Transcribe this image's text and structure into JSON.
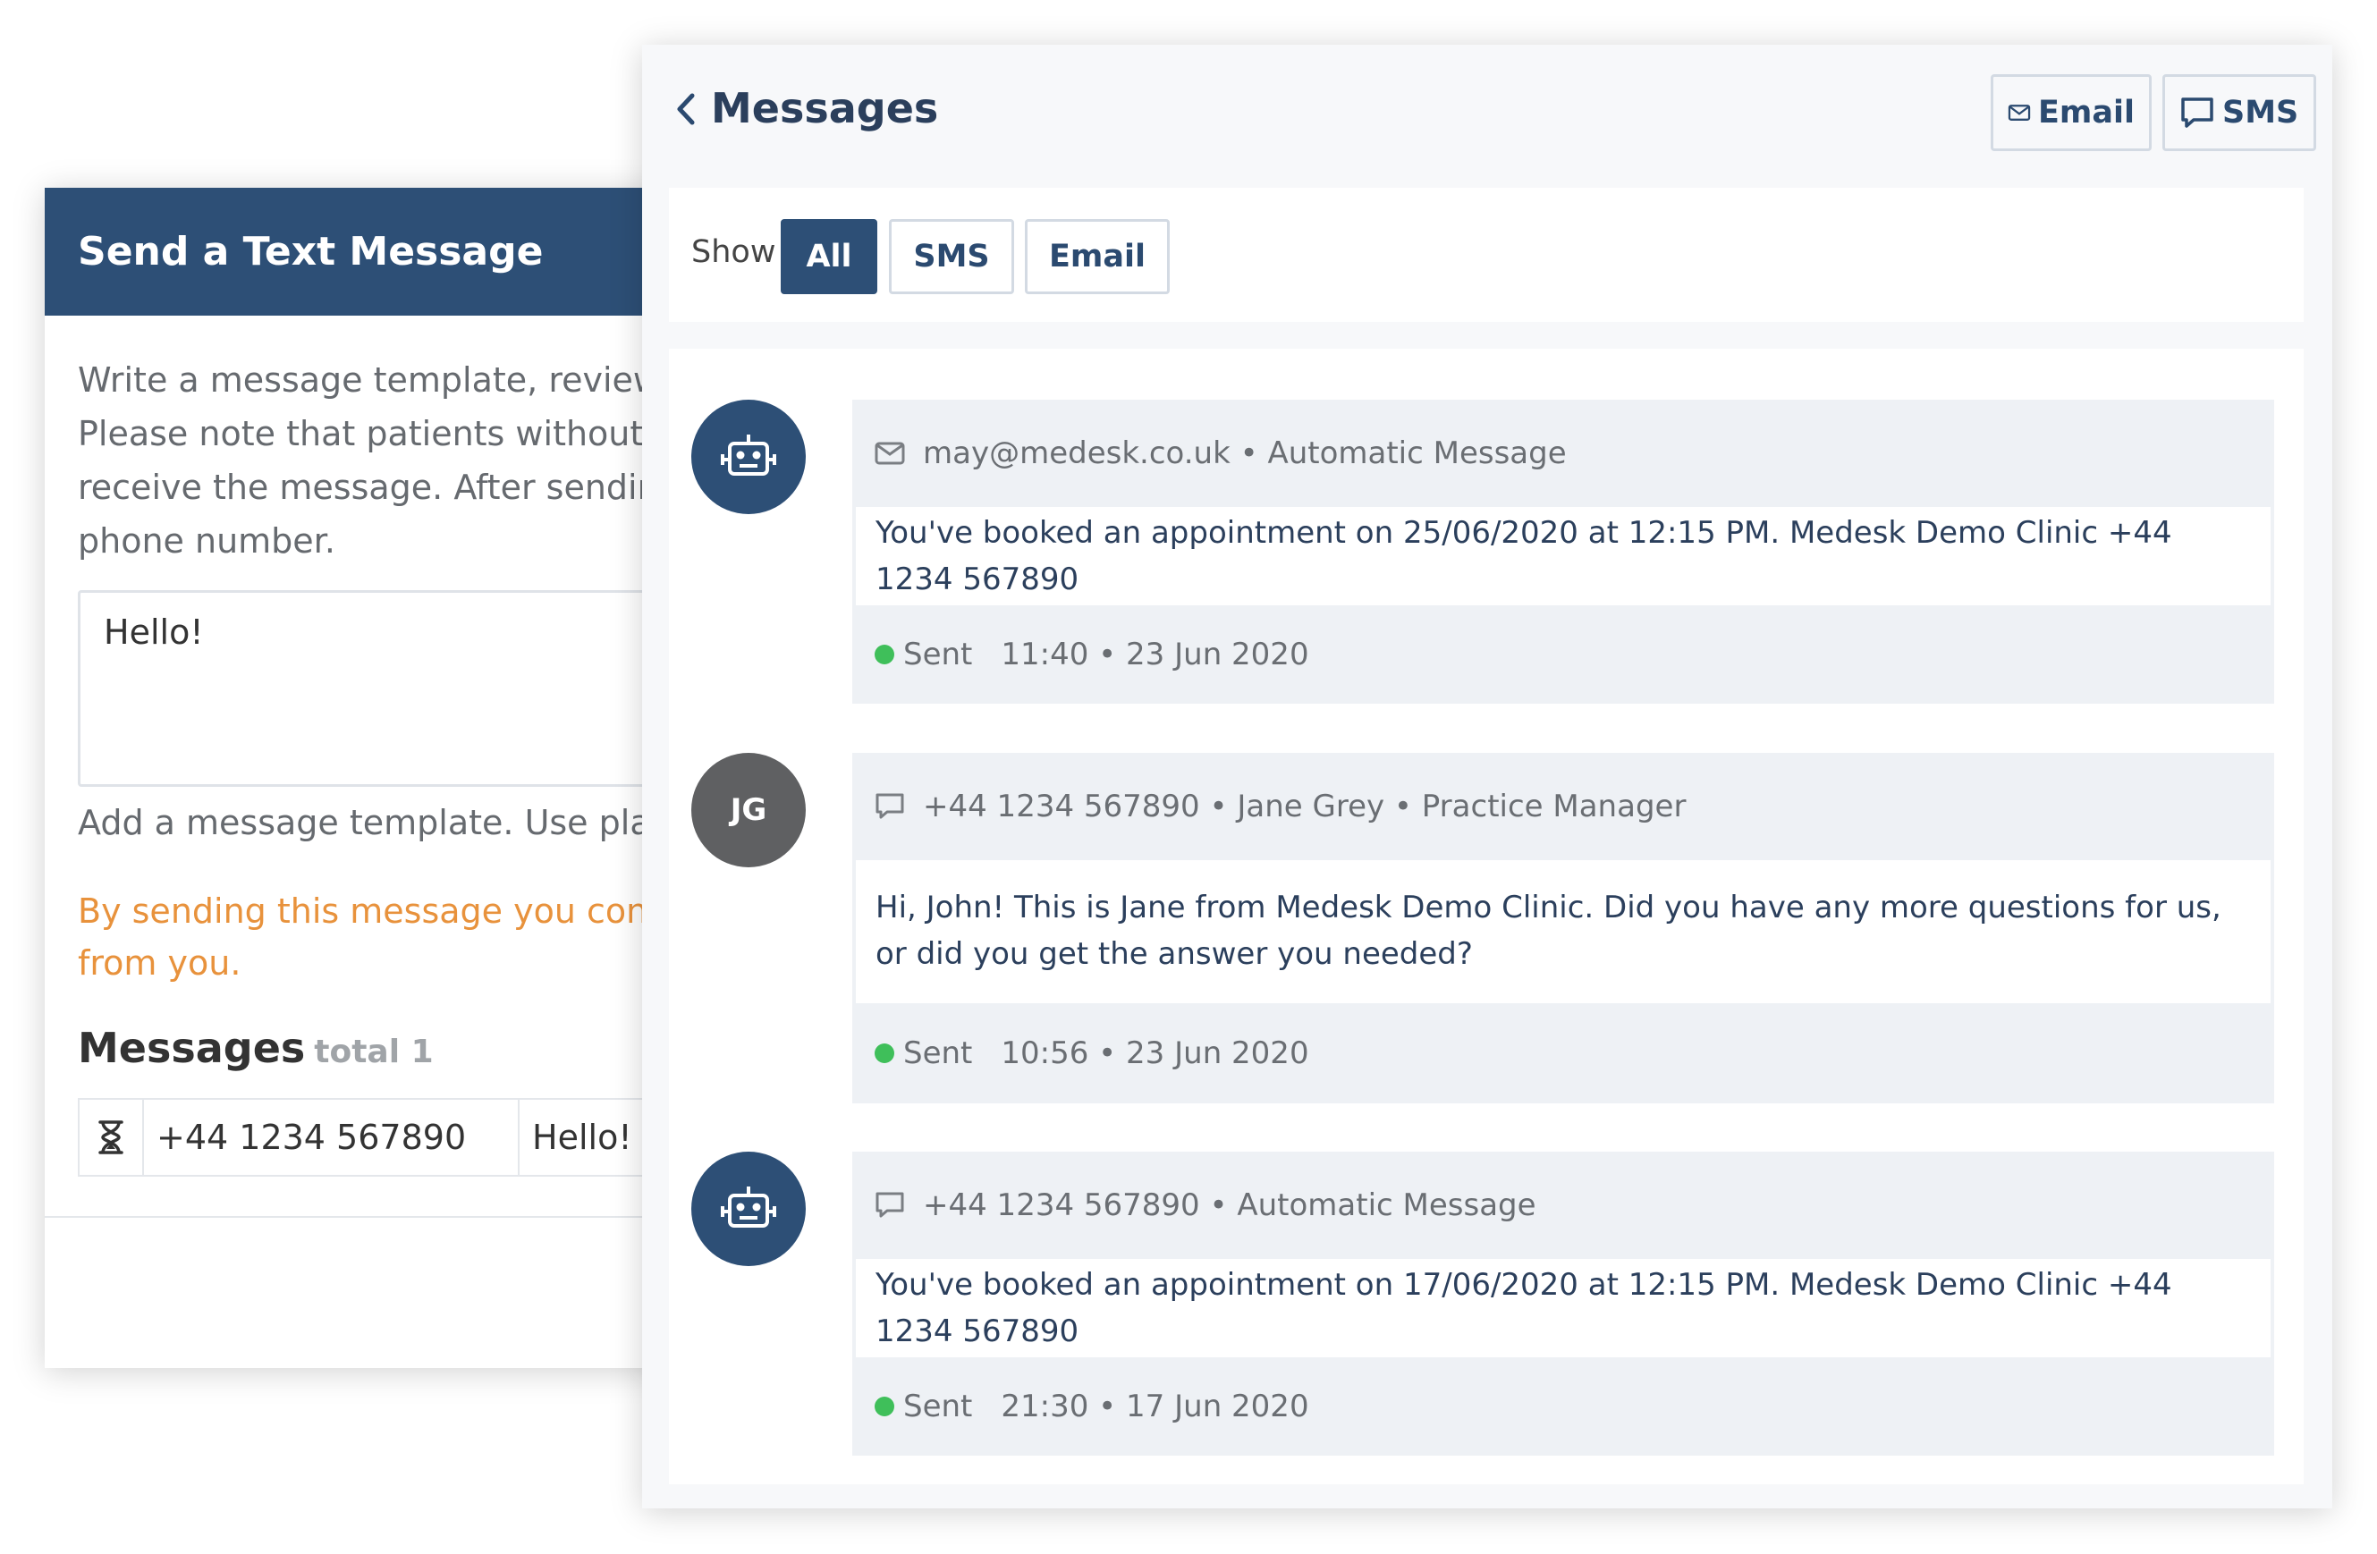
{
  "send_panel": {
    "title": "Send a Text Message",
    "description_lines": [
      "Write a message template, review t",
      "Please note that patients without m",
      "receive the message. After sending",
      "phone number."
    ],
    "textarea_value": "Hello!",
    "hint": "Add a message template. Use place",
    "warning_lines": [
      "By sending this message you confir",
      "from you."
    ],
    "messages_heading": "Messages",
    "messages_total": "total 1",
    "row": {
      "icon": "hourglass-icon",
      "phone": "+44 1234 567890",
      "message": "Hello!"
    }
  },
  "messages_panel": {
    "title": "Messages",
    "email_button": "Email",
    "sms_button": "SMS",
    "filter_label": "Show",
    "filters": [
      {
        "label": "All",
        "active": true
      },
      {
        "label": "SMS",
        "active": false
      },
      {
        "label": "Email",
        "active": false
      }
    ],
    "items": [
      {
        "avatar": "robot-icon",
        "channel_icon": "envelope-icon",
        "meta": "may@medesk.co.uk • Automatic Message",
        "body": "You've booked an appointment on 25/06/2020 at 12:15 PM. Medesk Demo Clinic +44 1234 567890",
        "status": "Sent",
        "time": "11:40 • 23 Jun 2020"
      },
      {
        "avatar_initials": "JG",
        "channel_icon": "chat-bubble-icon",
        "meta": "+44 1234 567890 • Jane Grey • Practice Manager",
        "body": "Hi, John! This is Jane from Medesk Demo Clinic. Did you have any more questions for us, or did you get the answer you needed?",
        "status": "Sent",
        "time": "10:56 • 23 Jun 2020"
      },
      {
        "avatar": "robot-icon",
        "channel_icon": "chat-bubble-icon",
        "meta": "+44 1234 567890 • Automatic Message",
        "body": "You've booked an appointment on 17/06/2020 at 12:15 PM. Medesk Demo Clinic +44 1234 567890",
        "status": "Sent",
        "time": "21:30 • 17 Jun 2020"
      }
    ]
  },
  "colors": {
    "primary": "#2d4f76",
    "warning": "#e8923c",
    "status_sent": "#3fbf5a"
  }
}
